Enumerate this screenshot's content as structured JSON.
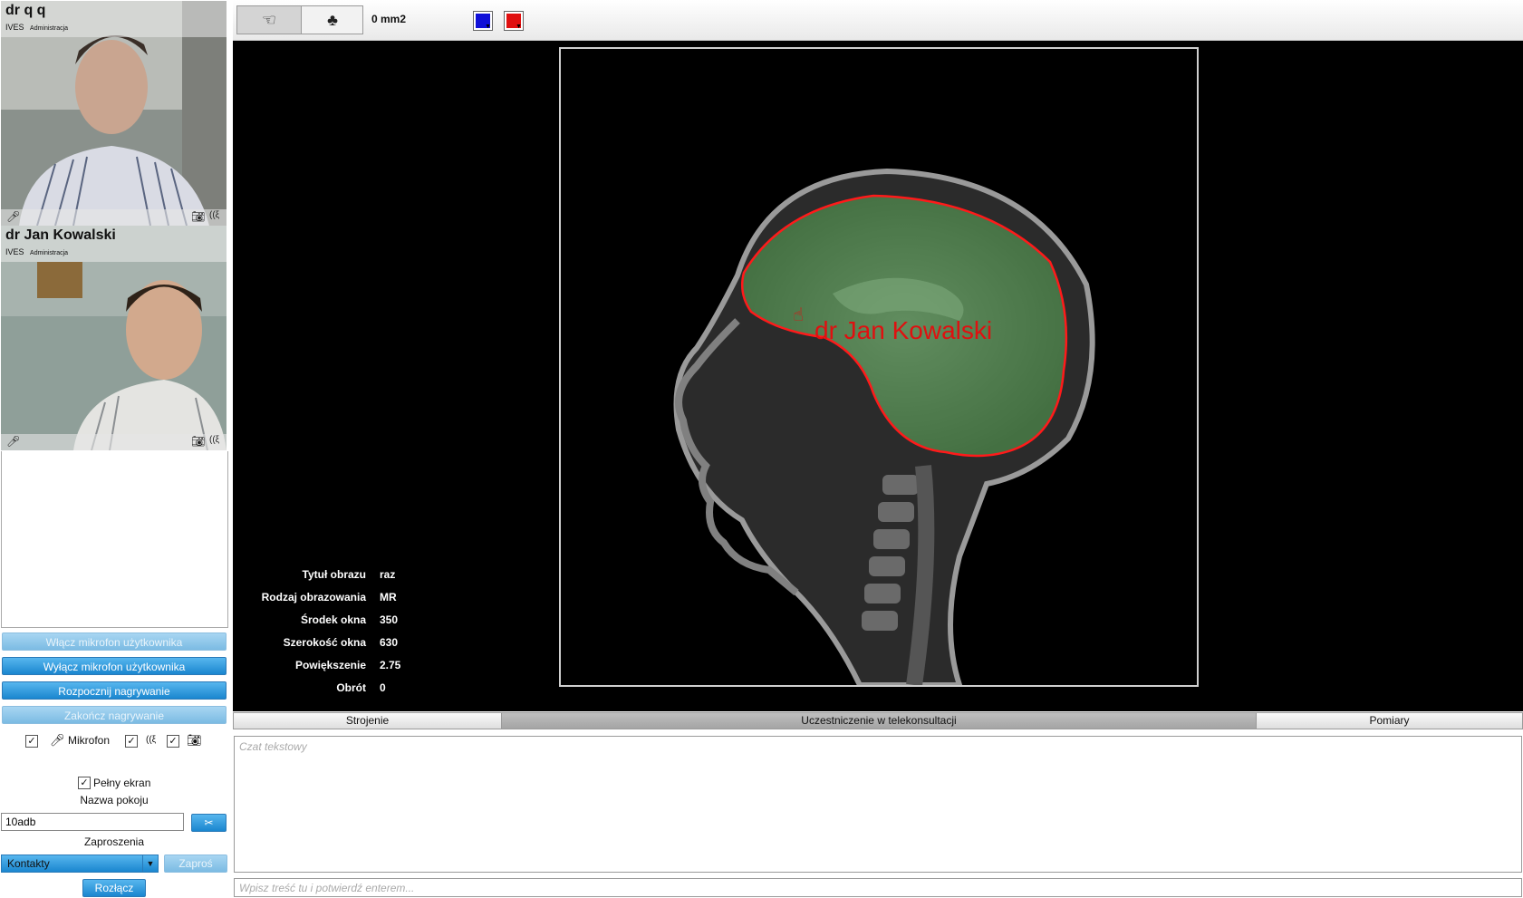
{
  "participants": [
    {
      "name": "dr q q",
      "org": "IVES",
      "role": "Administracja",
      "icons": [
        "microphone-icon",
        "camera-icon",
        "signal-icon"
      ]
    },
    {
      "name": "dr Jan Kowalski",
      "org": "IVES",
      "role": "Administracja",
      "icons": [
        "microphone-icon",
        "camera-icon",
        "signal-icon"
      ]
    }
  ],
  "controls": {
    "enable_mic": "Włącz mikrofon użytkownika",
    "disable_mic": "Wyłącz mikrofon użytkownika",
    "start_recording": "Rozpocznij nagrywanie",
    "stop_recording": "Zakończ nagrywanie",
    "microphone_label": "Mikrofon",
    "mic_checked": true,
    "signal_checked": true,
    "camera_checked": true,
    "fullscreen_label": "Pełny ekran",
    "fullscreen_checked": true,
    "room_name_label": "Nazwa pokoju",
    "room_name_value": "10adb",
    "invitations_label": "Zaproszenia",
    "contacts_selected": "Kontakty",
    "invite_button": "Zaproś",
    "disconnect_button": "Rozłącz",
    "scissors_icon": "scissors-icon"
  },
  "toolbar": {
    "tools": [
      "pointer-hand-icon",
      "shape-blob-icon"
    ],
    "area_readout": "0 mm2",
    "stroke_color": "#1010d8",
    "fill_color": "#e01010"
  },
  "image": {
    "annotation_text": "dr Jan Kowalski",
    "roi_fill": "#3f8f3c",
    "roi_stroke": "#ff1a1a"
  },
  "image_info": [
    {
      "key": "Tytuł obrazu",
      "value": "raz"
    },
    {
      "key": "Rodzaj obrazowania",
      "value": "MR"
    },
    {
      "key": "Środek okna",
      "value": "350"
    },
    {
      "key": "Szerokość okna",
      "value": "630"
    },
    {
      "key": "Powiększenie",
      "value": "2.75"
    },
    {
      "key": "Obrót",
      "value": "0"
    }
  ],
  "tabs": [
    {
      "label": "Strojenie",
      "active": false
    },
    {
      "label": "Uczestniczenie w telekonsultacji",
      "active": true
    },
    {
      "label": "Pomiary",
      "active": false
    }
  ],
  "chat": {
    "history_placeholder": "Czat tekstowy",
    "input_placeholder": "Wpisz treść tu i potwierdź enterem..."
  }
}
